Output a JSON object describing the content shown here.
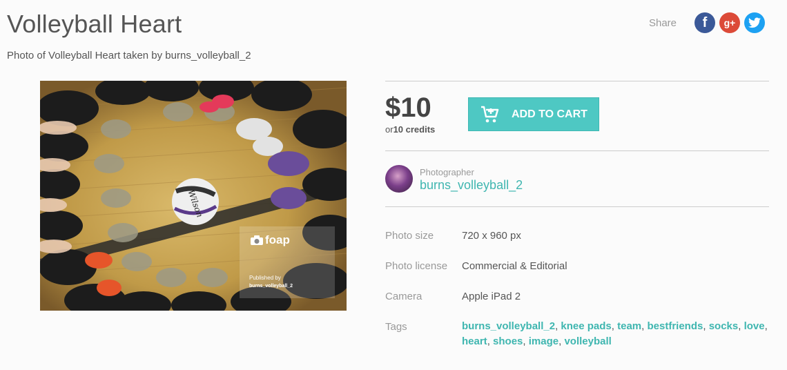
{
  "header": {
    "title": "Volleyball Heart",
    "subtitle": "Photo of Volleyball Heart taken by burns_volleyball_2"
  },
  "share": {
    "label": "Share",
    "networks": [
      "facebook",
      "google-plus",
      "twitter"
    ]
  },
  "photo": {
    "watermark_logo": "foap",
    "published_by": "Published by",
    "published_user": "burns_volleyball_2"
  },
  "pricing": {
    "price": "$10",
    "or": "or",
    "credits": "10 credits",
    "add_to_cart": "ADD TO CART"
  },
  "photographer": {
    "label": "Photographer",
    "name": "burns_volleyball_2"
  },
  "details": [
    {
      "label": "Photo size",
      "value": "720 x 960 px"
    },
    {
      "label": "Photo license",
      "value": "Commercial & Editorial"
    },
    {
      "label": "Camera",
      "value": "Apple iPad 2"
    }
  ],
  "tags_label": "Tags",
  "tags": [
    "burns_volleyball_2",
    "knee pads",
    "team",
    "bestfriends",
    "socks",
    "love",
    "heart",
    "shoes",
    "image",
    "volleyball"
  ],
  "colors": {
    "accent": "#4ec8c3",
    "link": "#3fb6b0",
    "facebook": "#3b5998",
    "google_plus": "#dc4a38",
    "twitter": "#1da1f2"
  }
}
